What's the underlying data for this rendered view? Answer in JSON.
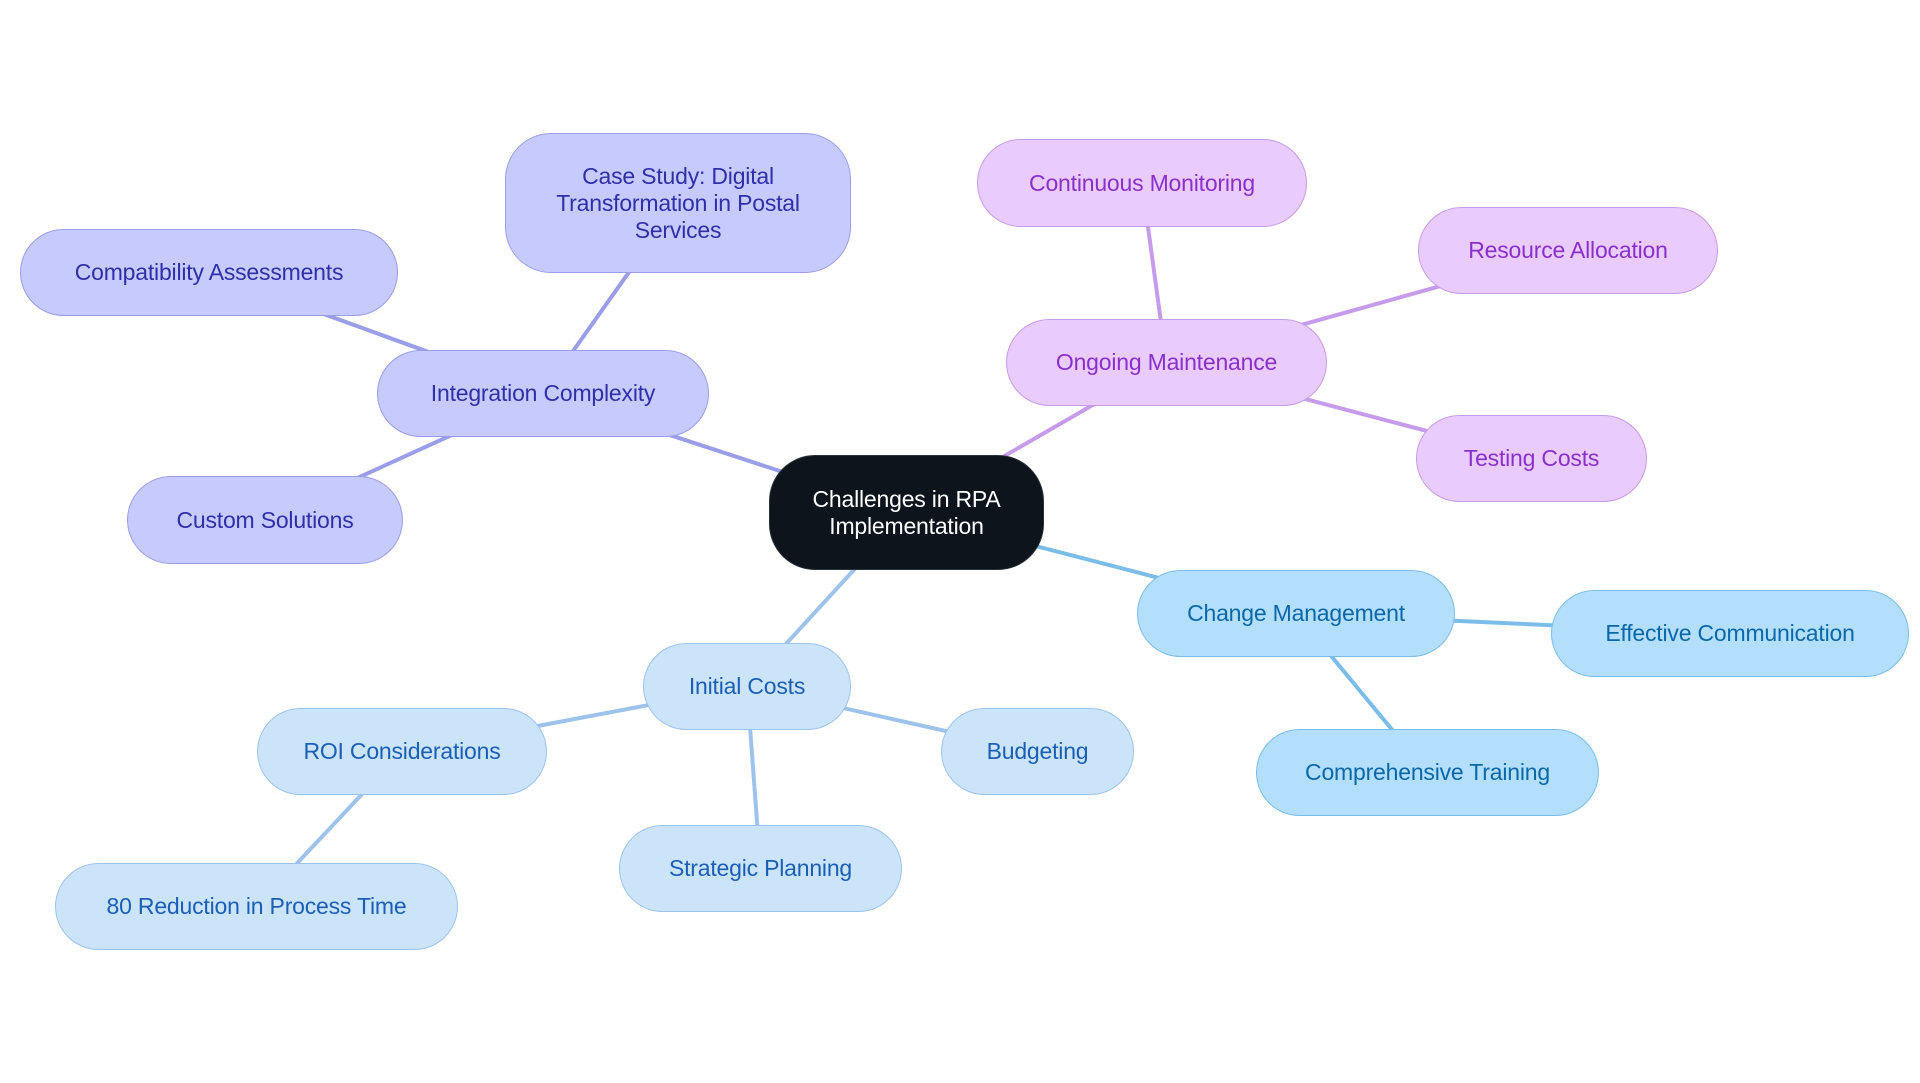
{
  "diagram": {
    "type": "mindmap",
    "root": {
      "id": "root",
      "label": "Challenges in RPA\nImplementation"
    },
    "branches": [
      {
        "id": "integration",
        "label": "Integration Complexity",
        "group": "indigo",
        "children": [
          {
            "id": "case-study",
            "label": "Case Study: Digital\nTransformation in Postal\nServices"
          },
          {
            "id": "compat",
            "label": "Compatibility Assessments"
          },
          {
            "id": "custom",
            "label": "Custom Solutions"
          }
        ]
      },
      {
        "id": "maintenance",
        "label": "Ongoing Maintenance",
        "group": "purple",
        "children": [
          {
            "id": "monitoring",
            "label": "Continuous Monitoring"
          },
          {
            "id": "resource",
            "label": "Resource Allocation"
          },
          {
            "id": "testing",
            "label": "Testing Costs"
          }
        ]
      },
      {
        "id": "change",
        "label": "Change Management",
        "group": "sky",
        "children": [
          {
            "id": "communication",
            "label": "Effective Communication"
          },
          {
            "id": "training",
            "label": "Comprehensive Training"
          }
        ]
      },
      {
        "id": "initial",
        "label": "Initial Costs",
        "group": "light",
        "children": [
          {
            "id": "roi",
            "label": "ROI Considerations",
            "children": [
              {
                "id": "reduction",
                "label": "80 Reduction in Process Time"
              }
            ]
          },
          {
            "id": "strategic",
            "label": "Strategic Planning"
          },
          {
            "id": "budgeting",
            "label": "Budgeting"
          }
        ]
      }
    ],
    "colors": {
      "root": "#0d141b",
      "indigo": "#c7cafd",
      "purple": "#e9cbfd",
      "light": "#cce4fa",
      "sky": "#b3defc"
    },
    "edge_colors": {
      "indigo": "#9a9de8",
      "purple": "#c79beb",
      "light": "#9dc3ec",
      "sky": "#7bbde8"
    }
  }
}
